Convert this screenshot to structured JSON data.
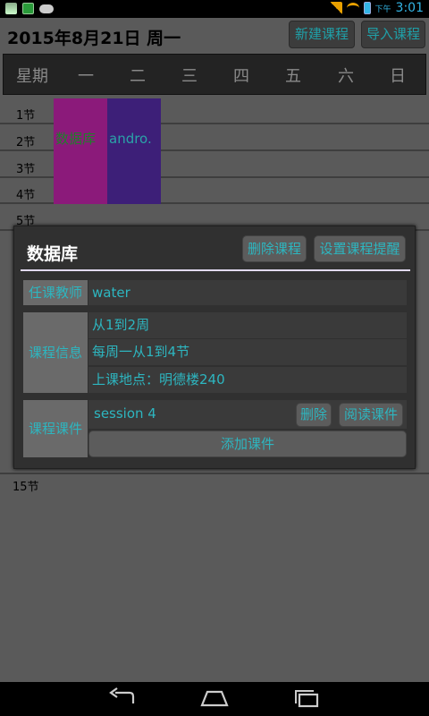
{
  "status_bar": {
    "ampm": "下午",
    "time": "3:01",
    "icons": [
      "app-icon",
      "app-icon",
      "cloud-icon",
      "signal-icon",
      "wifi-icon",
      "battery-icon"
    ]
  },
  "header": {
    "date_title": "2015年8月21日  周一",
    "new_course_button": "新建课程",
    "import_course_button": "导入课程"
  },
  "week_header": {
    "label": "星期",
    "days": [
      "一",
      "二",
      "三",
      "四",
      "五",
      "六",
      "日"
    ]
  },
  "timetable": {
    "slots": [
      "1节",
      "2节",
      "3节",
      "4节",
      "5节",
      "15节"
    ],
    "courses": [
      {
        "name": "数据库",
        "day": "一",
        "from": 1,
        "to": 4,
        "color": "#8b1a7a"
      },
      {
        "name": "andro.",
        "day": "二",
        "from": 1,
        "to": 4,
        "color": "#3d1f78"
      }
    ]
  },
  "dialog": {
    "title": "数据库",
    "delete_course_button": "删除课程",
    "set_reminder_button": "设置课程提醒",
    "teacher_label": "任课教师",
    "teacher_value": "water",
    "info_label": "课程信息",
    "info_weeks": "从1到2周",
    "info_sections": "每周一从1到4节",
    "info_location": "上课地点：明德楼240",
    "courseware_label": "课程课件",
    "courseware_items": [
      {
        "name": "session 4",
        "delete_label": "删除",
        "read_label": "阅读课件"
      }
    ],
    "add_courseware_button": "添加课件"
  },
  "colors": {
    "accent": "#2db6c0",
    "background": "#5a5a5a",
    "dialog": "#303030"
  }
}
